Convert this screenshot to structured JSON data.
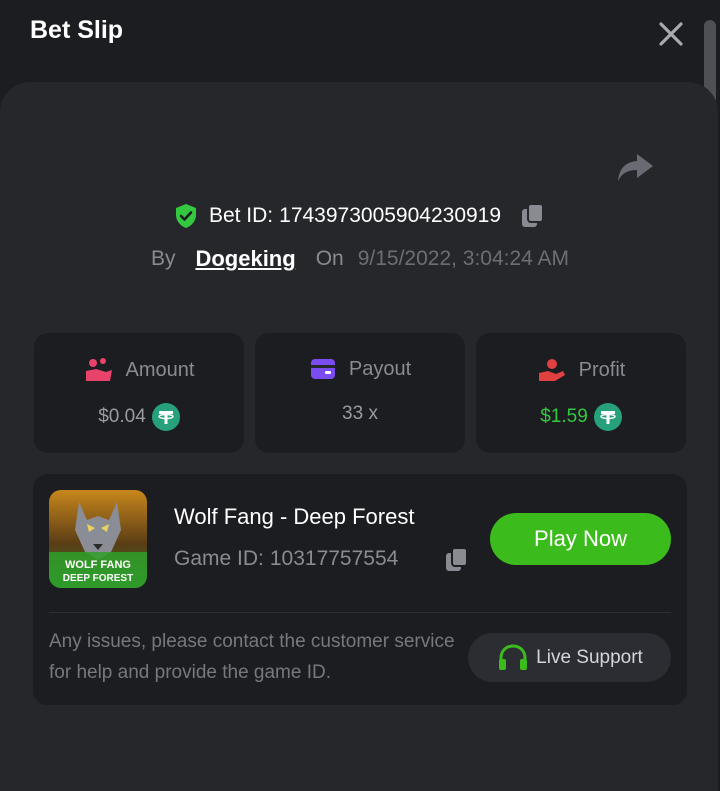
{
  "header": {
    "title": "Bet Slip"
  },
  "bet": {
    "id_label": "Bet ID:",
    "id_value": "1743973005904230919",
    "by_label": "By",
    "user": "Dogeking",
    "on_label": "On",
    "date": "9/15/2022, 3:04:24 AM"
  },
  "stats": {
    "amount": {
      "label": "Amount",
      "value": "$0.04"
    },
    "payout": {
      "label": "Payout",
      "value": "33 x"
    },
    "profit": {
      "label": "Profit",
      "value": "$1.59"
    }
  },
  "game": {
    "name": "Wolf Fang - Deep Forest",
    "id_label": "Game ID:",
    "id_value": "10317757554",
    "play_label": "Play Now",
    "thumb_line1": "WOLF FANG",
    "thumb_line2": "DEEP FOREST"
  },
  "support": {
    "text": "Any issues, please contact the customer service for help and provide the game ID.",
    "button_label": "Live Support"
  },
  "colors": {
    "accent_green": "#3cbc1c",
    "profit_green": "#33c840",
    "tether_teal": "#26a17b",
    "amount_pink": "#e8436a",
    "payout_purple": "#7b4cf0",
    "profit_red": "#e04040"
  },
  "icons": [
    "close-icon",
    "share-icon",
    "shield-check-icon",
    "copy-icon",
    "hand-coins-icon",
    "wallet-card-icon",
    "hand-heart-icon",
    "tether-icon",
    "headset-icon"
  ]
}
